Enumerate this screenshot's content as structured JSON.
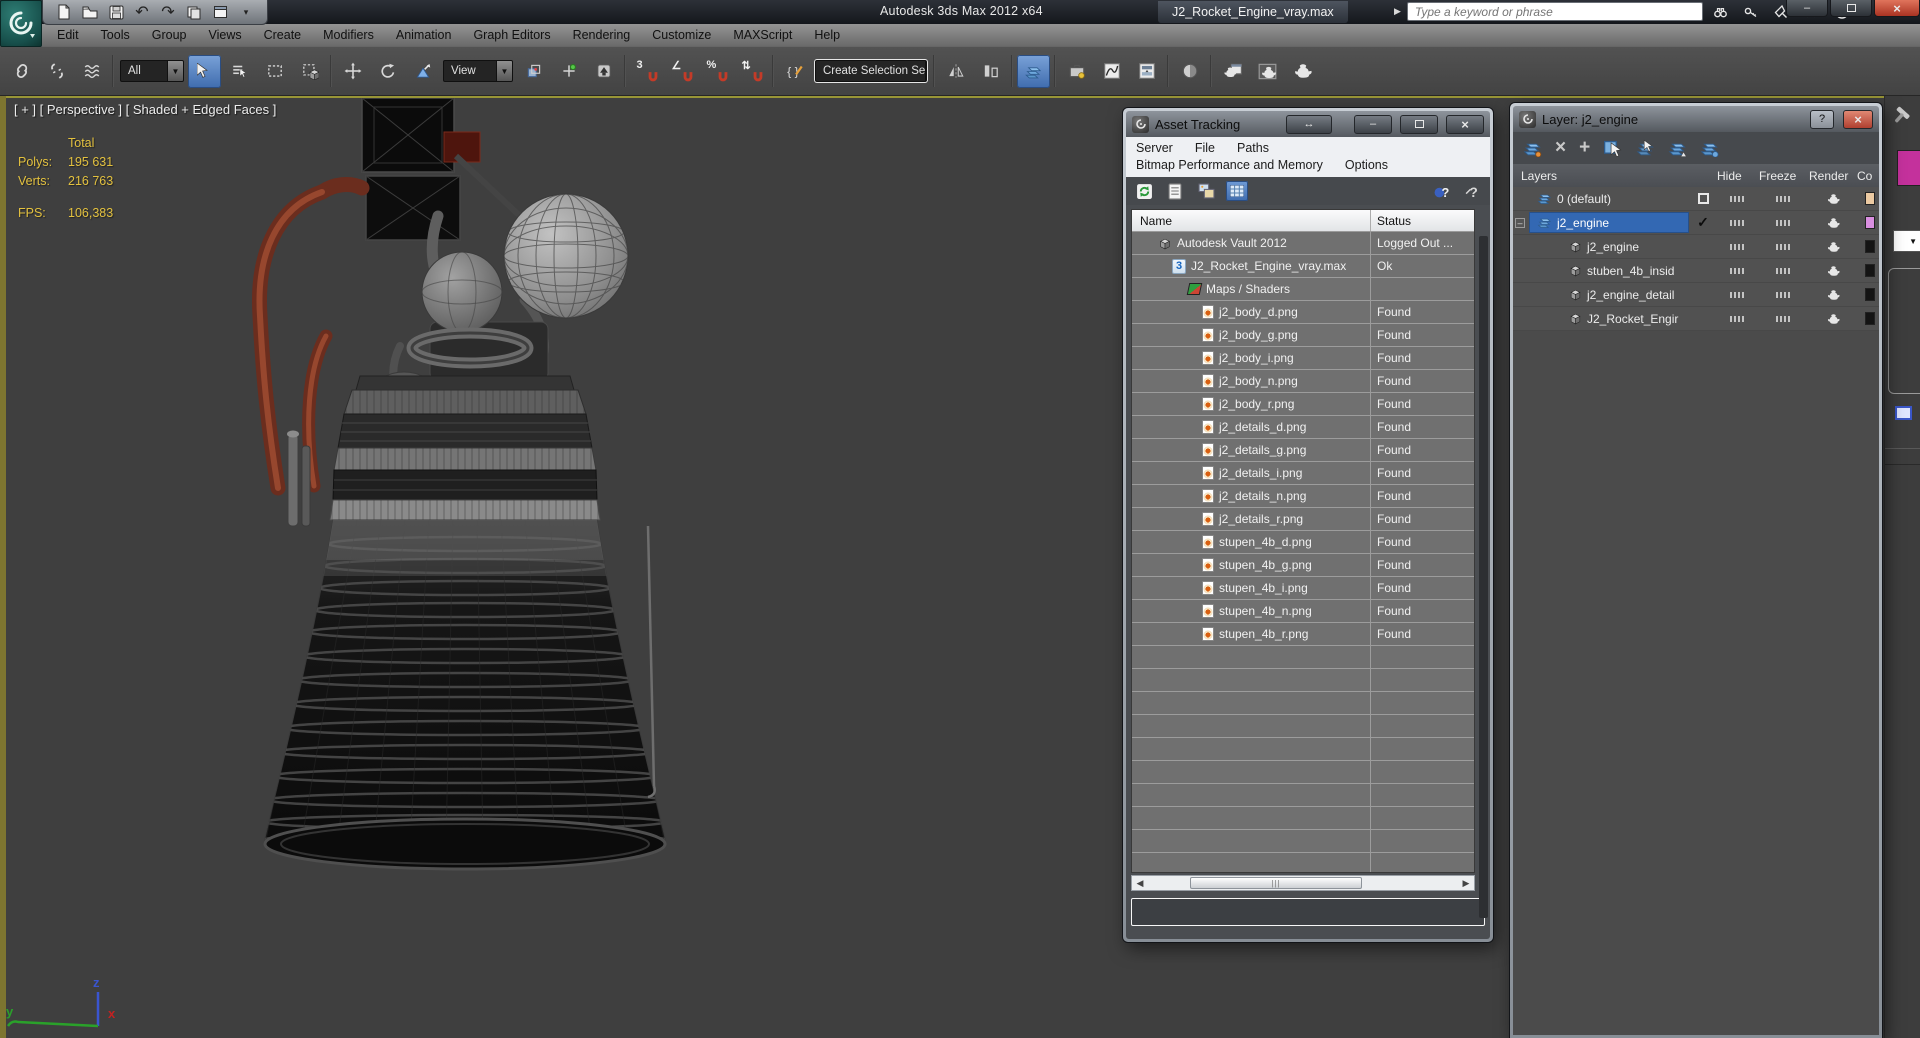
{
  "app": {
    "title": "Autodesk 3ds Max 2012 x64",
    "document": "J2_Rocket_Engine_vray.max",
    "search_placeholder": "Type a keyword or phrase"
  },
  "menus": [
    "Edit",
    "Tools",
    "Group",
    "Views",
    "Create",
    "Modifiers",
    "Animation",
    "Graph Editors",
    "Rendering",
    "Customize",
    "MAXScript",
    "Help"
  ],
  "toolbar": {
    "selection_filter": "All",
    "coord_system": "View",
    "named_sets": "Create Selection Se"
  },
  "viewport": {
    "label": "[ + ] [ Perspective ] [ Shaded + Edged Faces ]",
    "stats": {
      "total": "Total",
      "polys_label": "Polys:",
      "polys": "195 631",
      "verts_label": "Verts:",
      "verts": "216 763",
      "fps_label": "FPS:",
      "fps": "106,383"
    },
    "axis": {
      "x": "x",
      "y": "y",
      "z": "z"
    }
  },
  "asset_tracking": {
    "title": "Asset Tracking",
    "menus1": [
      "Server",
      "File",
      "Paths"
    ],
    "menus2": [
      "Bitmap Performance and Memory",
      "Options"
    ],
    "columns": {
      "name": "Name",
      "status": "Status"
    },
    "rows": [
      {
        "name": "Autodesk Vault 2012",
        "status": "Logged Out ..."
      },
      {
        "name": "J2_Rocket_Engine_vray.max",
        "status": "Ok"
      },
      {
        "name": "Maps / Shaders",
        "status": ""
      },
      {
        "name": "j2_body_d.png",
        "status": "Found"
      },
      {
        "name": "j2_body_g.png",
        "status": "Found"
      },
      {
        "name": "j2_body_i.png",
        "status": "Found"
      },
      {
        "name": "j2_body_n.png",
        "status": "Found"
      },
      {
        "name": "j2_body_r.png",
        "status": "Found"
      },
      {
        "name": "j2_details_d.png",
        "status": "Found"
      },
      {
        "name": "j2_details_g.png",
        "status": "Found"
      },
      {
        "name": "j2_details_i.png",
        "status": "Found"
      },
      {
        "name": "j2_details_n.png",
        "status": "Found"
      },
      {
        "name": "j2_details_r.png",
        "status": "Found"
      },
      {
        "name": "stupen_4b_d.png",
        "status": "Found"
      },
      {
        "name": "stupen_4b_g.png",
        "status": "Found"
      },
      {
        "name": "stupen_4b_i.png",
        "status": "Found"
      },
      {
        "name": "stupen_4b_n.png",
        "status": "Found"
      },
      {
        "name": "stupen_4b_r.png",
        "status": "Found"
      }
    ]
  },
  "layer_panel": {
    "title": "Layer: j2_engine",
    "columns": {
      "layers": "Layers",
      "hide": "Hide",
      "freeze": "Freeze",
      "render": "Render",
      "color": "Co"
    },
    "rows": [
      {
        "label": "0 (default)",
        "swatch": "#eccaa2"
      },
      {
        "label": "j2_engine",
        "swatch": "#d98fe0"
      },
      {
        "label": "j2_engine",
        "swatch": "#141414"
      },
      {
        "label": "stuben_4b_insid",
        "swatch": "#141414"
      },
      {
        "label": "j2_engine_detail",
        "swatch": "#141414"
      },
      {
        "label": "J2_Rocket_Engir",
        "swatch": "#141414"
      }
    ]
  },
  "colors": {
    "accent_blue": "#4a7cc0",
    "selection_blue": "#3368b3",
    "stats_yellow": "#e3c13f",
    "object_color_swatch": "#c4319c"
  }
}
